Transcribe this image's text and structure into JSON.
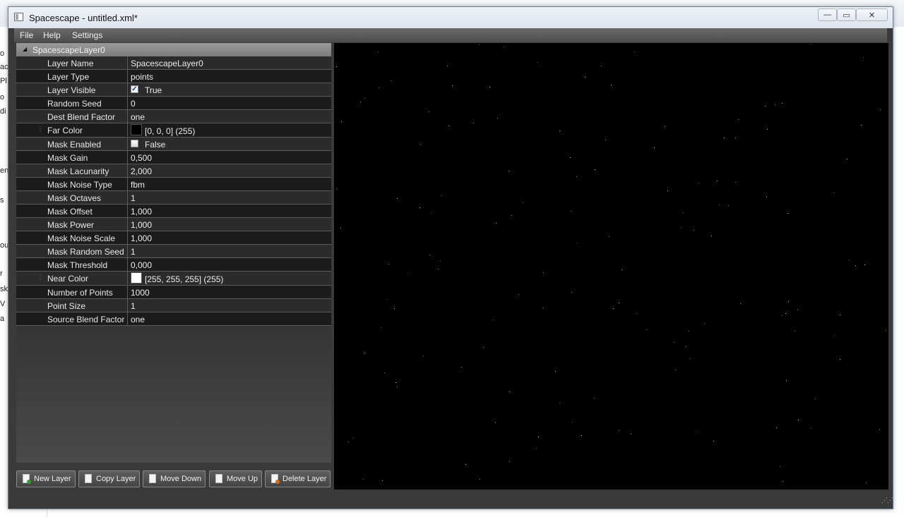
{
  "background": {
    "left_fragments": [
      "o",
      "ac",
      "Pl",
      "o",
      "di",
      "en",
      "s",
      "ou",
      "r",
      "sk",
      "V D",
      "a"
    ]
  },
  "window": {
    "title": "Spacescape - untitled.xml*",
    "controls": {
      "minimize": "—",
      "maximize": "▭",
      "close": "✕"
    }
  },
  "menu": {
    "file": "File",
    "help": "Help",
    "settings": "Settings"
  },
  "layer": {
    "header": "SpacescapeLayer0",
    "properties": [
      {
        "name": "Layer Name",
        "value": "SpacescapeLayer0"
      },
      {
        "name": "Layer Type",
        "value": "points"
      },
      {
        "name": "Layer Visible",
        "value": "True",
        "checkbox": true,
        "checked": true
      },
      {
        "name": "Random Seed",
        "value": "0"
      },
      {
        "name": "Dest Blend Factor",
        "value": "one"
      },
      {
        "name": "Far Color",
        "value": "[0, 0, 0] (255)",
        "swatch": "#000000"
      },
      {
        "name": "Mask Enabled",
        "value": "False",
        "checkbox": true,
        "checked": false
      },
      {
        "name": "Mask Gain",
        "value": "0,500"
      },
      {
        "name": "Mask Lacunarity",
        "value": "2,000"
      },
      {
        "name": "Mask Noise Type",
        "value": "fbm"
      },
      {
        "name": "Mask Octaves",
        "value": "1"
      },
      {
        "name": "Mask Offset",
        "value": "1,000"
      },
      {
        "name": "Mask Power",
        "value": "1,000"
      },
      {
        "name": "Mask Noise Scale",
        "value": "1,000"
      },
      {
        "name": "Mask Random Seed",
        "value": "1"
      },
      {
        "name": "Mask Threshold",
        "value": "0,000"
      },
      {
        "name": "Near Color",
        "value": "[255, 255, 255] (255)",
        "swatch": "#ffffff"
      },
      {
        "name": "Number of Points",
        "value": "1000"
      },
      {
        "name": "Point Size",
        "value": "1"
      },
      {
        "name": "Source Blend Factor",
        "value": "one"
      }
    ]
  },
  "buttons": {
    "new_layer": "New Layer",
    "copy_layer": "Copy Layer",
    "move_down": "Move Down",
    "move_up": "Move Up",
    "delete_layer": "Delete Layer"
  },
  "colors": {
    "canvas_bg": "#000000",
    "panel_bg": "#2b2b2b",
    "header_bg": "#8c8c8c",
    "text": "#e8e8e8"
  }
}
